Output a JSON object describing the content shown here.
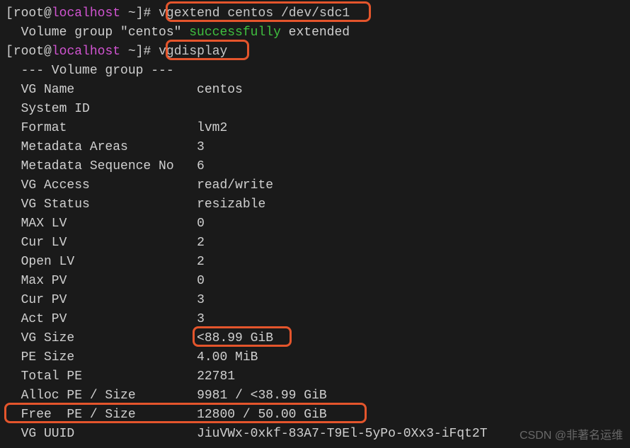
{
  "prompt": {
    "user": "root",
    "host": "localhost",
    "path": "~",
    "symbol": "#"
  },
  "cmd1": "vgextend centos /dev/sdc1",
  "output1": {
    "prefix": "  Volume group \"centos\" ",
    "status": "successfully",
    "suffix": " extended"
  },
  "cmd2": "vgdisplay",
  "vg": {
    "header": "  --- Volume group ---",
    "rows": [
      {
        "label": "  VG Name",
        "value": "centos"
      },
      {
        "label": "  System ID",
        "value": ""
      },
      {
        "label": "  Format",
        "value": "lvm2"
      },
      {
        "label": "  Metadata Areas",
        "value": "3"
      },
      {
        "label": "  Metadata Sequence No",
        "value": "6"
      },
      {
        "label": "  VG Access",
        "value": "read/write"
      },
      {
        "label": "  VG Status",
        "value": "resizable"
      },
      {
        "label": "  MAX LV",
        "value": "0"
      },
      {
        "label": "  Cur LV",
        "value": "2"
      },
      {
        "label": "  Open LV",
        "value": "2"
      },
      {
        "label": "  Max PV",
        "value": "0"
      },
      {
        "label": "  Cur PV",
        "value": "3"
      },
      {
        "label": "  Act PV",
        "value": "3"
      },
      {
        "label": "  VG Size",
        "value": "<88.99 GiB"
      },
      {
        "label": "  PE Size",
        "value": "4.00 MiB"
      },
      {
        "label": "  Total PE",
        "value": "22781"
      },
      {
        "label": "  Alloc PE / Size",
        "value": "9981 / <38.99 GiB"
      },
      {
        "label": "  Free  PE / Size",
        "value": "12800 / 50.00 GiB"
      },
      {
        "label": "  VG UUID",
        "value": "JiuVWx-0xkf-83A7-T9El-5yPo-0Xx3-iFqt2T"
      }
    ]
  },
  "watermark": "CSDN @非著名运维"
}
